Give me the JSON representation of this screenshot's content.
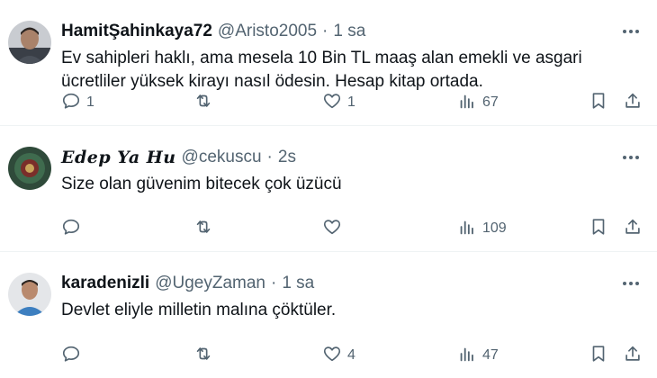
{
  "colors": {
    "text": "#0f1419",
    "muted": "#536471",
    "divider": "#eff3f4"
  },
  "tweets": [
    {
      "display_name": "HamitŞahinkaya72",
      "handle": "@Aristo2005",
      "separator": "·",
      "time": "1 sa",
      "text": "Ev sahipleri haklı, ama mesela 10 Bin TL maaş alan emekli ve asgari ücretliler yüksek kirayı nasıl ödesin. Hesap kitap ortada.",
      "replies": "1",
      "retweets": "",
      "likes": "1",
      "views": "67",
      "icons": [
        "more-icon",
        "reply-icon",
        "retweet-icon",
        "like-icon",
        "views-icon",
        "bookmark-icon",
        "share-icon"
      ]
    },
    {
      "display_name": "Edep Ya Hu",
      "handle": "@cekuscu",
      "separator": "·",
      "time": "2s",
      "text": "Size olan güvenim bitecek çok üzücü",
      "replies": "",
      "retweets": "",
      "likes": "",
      "views": "109",
      "icons": [
        "more-icon",
        "reply-icon",
        "retweet-icon",
        "like-icon",
        "views-icon",
        "bookmark-icon",
        "share-icon"
      ]
    },
    {
      "display_name": "karadenizli",
      "handle": "@UgeyZaman",
      "separator": "·",
      "time": "1 sa",
      "text": "Devlet eliyle milletin malına çöktüler.",
      "replies": "",
      "retweets": "",
      "likes": "4",
      "views": "47",
      "icons": [
        "more-icon",
        "reply-icon",
        "retweet-icon",
        "like-icon",
        "views-icon",
        "bookmark-icon",
        "share-icon"
      ]
    }
  ]
}
